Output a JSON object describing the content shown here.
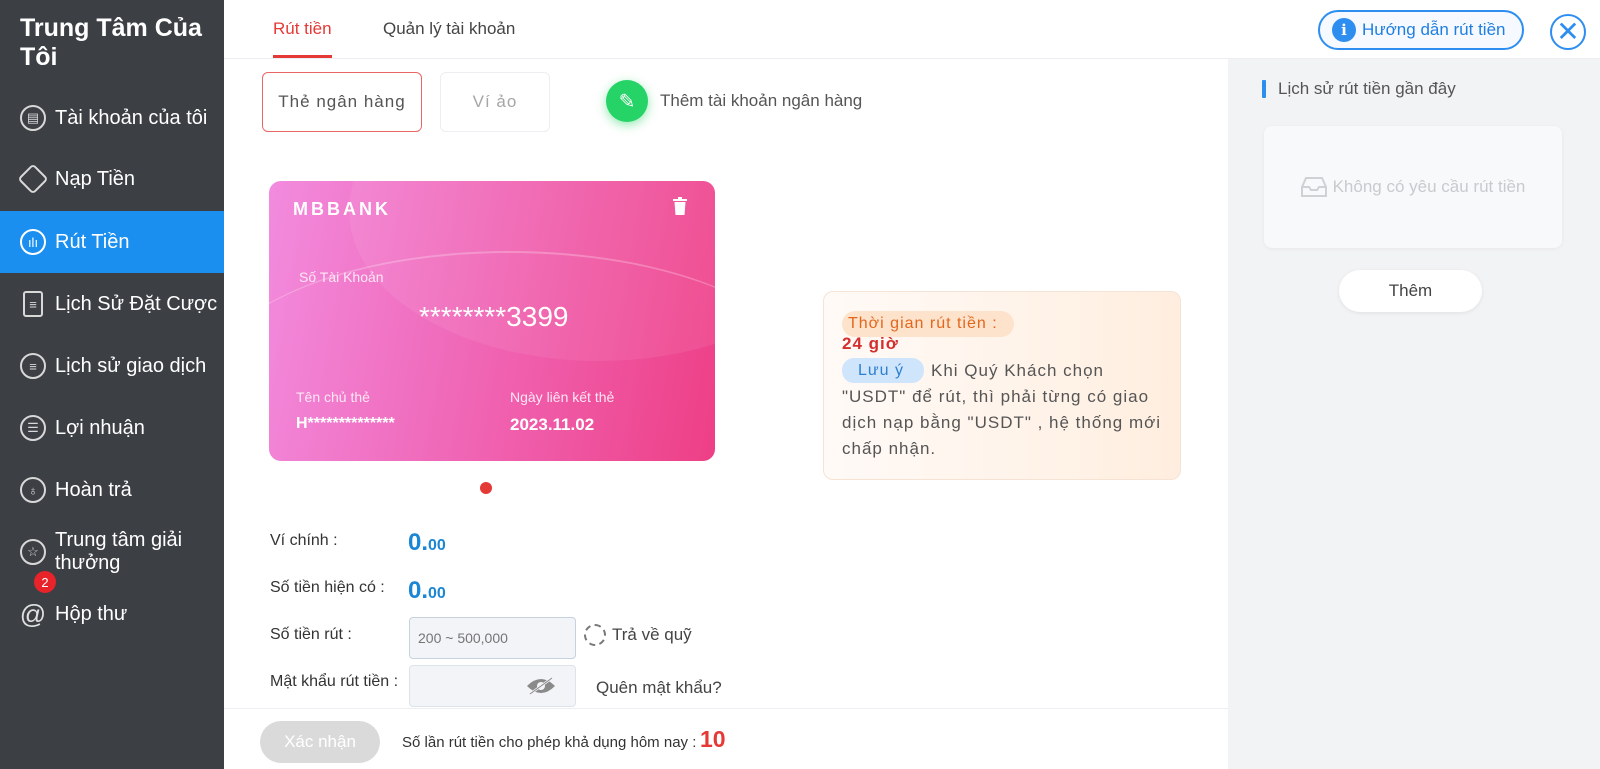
{
  "sidebar": {
    "title": "Trung Tâm Của Tôi",
    "items": [
      {
        "label": "Tài khoản của tôi",
        "icon": "account-icon"
      },
      {
        "label": "Nạp Tiền",
        "icon": "deposit-icon"
      },
      {
        "label": "Rút Tiền",
        "icon": "withdraw-icon",
        "active": true
      },
      {
        "label": "Lịch Sử Đặt Cược",
        "icon": "bet-history-icon"
      },
      {
        "label": "Lịch sử giao dịch",
        "icon": "transaction-history-icon"
      },
      {
        "label": "Lợi nhuận",
        "icon": "profit-icon"
      },
      {
        "label": "Hoàn trả",
        "icon": "rebate-icon"
      },
      {
        "label": "Trung tâm giải thưởng",
        "icon": "reward-icon"
      },
      {
        "label": "Hộp thư",
        "icon": "mail-icon",
        "badge": "2"
      }
    ]
  },
  "header": {
    "tabs": [
      {
        "label": "Rút tiền",
        "active": true
      },
      {
        "label": "Quản lý tài khoản",
        "active": false
      }
    ],
    "guide_button": "Hướng dẫn rút tiền"
  },
  "subtabs": {
    "bank_card": "Thẻ ngân hàng",
    "virtual_wallet": "Ví ảo",
    "add_bank": "Thêm tài khoản ngân hàng"
  },
  "card": {
    "bank_name": "MBBANK",
    "account_label": "Số Tài Khoản",
    "account_number": "********3399",
    "holder_label": "Tên chủ thẻ",
    "holder_value": "H**************",
    "date_label": "Ngày liên kết thẻ",
    "date_value": "2023.11.02"
  },
  "info": {
    "time_label": "Thời gian rút tiền :",
    "time_value": "24 giờ",
    "note_label": "Lưu ý",
    "note_text": "Khi Quý Khách chọn \"USDT\" để rút, thì phải từng có giao dịch nạp bằng \"USDT\" , hệ thống mới chấp nhận."
  },
  "form": {
    "main_wallet_label": "Ví chính :",
    "main_wallet_int": "0.",
    "main_wallet_dec": "00",
    "available_label": "Số tiền hiện có :",
    "available_int": "0.",
    "available_dec": "00",
    "amount_label": "Số tiền rút :",
    "amount_placeholder": "200 ~ 500,000",
    "refresh_label": "Trả về quỹ",
    "password_label": "Mật khẩu rút tiền :",
    "forgot_label": "Quên mật khẩu?"
  },
  "footer": {
    "confirm_label": "Xác nhận",
    "limit_text": "Số lần rút tiền cho phép khả dụng hôm nay :",
    "limit_value": "10"
  },
  "history": {
    "title": "Lịch sử rút tiền gần đây",
    "empty_text": "Không có yêu cầu rút tiền",
    "more_label": "Thêm"
  },
  "colors": {
    "accent": "#e53935",
    "primary_blue": "#1a8ff0",
    "sidebar_bg": "#3c3f44"
  }
}
